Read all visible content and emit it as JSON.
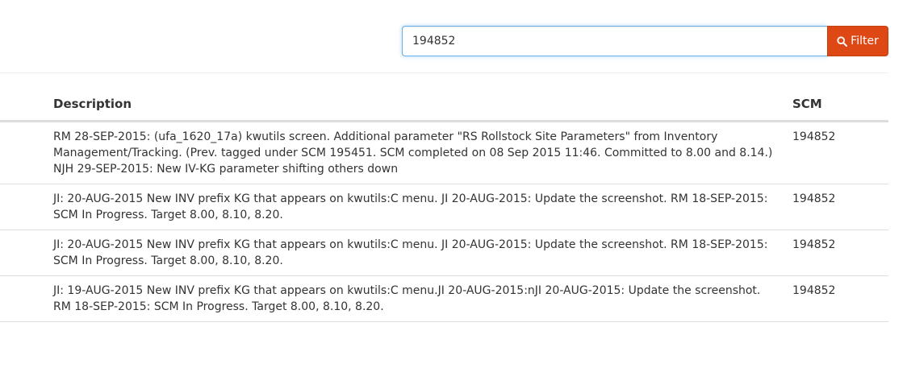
{
  "search": {
    "value": "194852",
    "button_label": "Filter",
    "button_icon": "search-icon",
    "accent_color": "#dd4814"
  },
  "table": {
    "columns": [
      "Description",
      "SCM"
    ],
    "rows": [
      {
        "description": "RM 28-SEP-2015: (ufa_1620_17a) kwutils screen. Additional parameter \"RS Rollstock Site Parameters\" from Inventory Management/Tracking. (Prev. tagged under SCM 195451. SCM completed on 08 Sep 2015 11:46. Committed to 8.00 and 8.14.) NJH 29-SEP-2015: New IV-KG parameter shifting others down",
        "scm": "194852"
      },
      {
        "description": "JI: 20-AUG-2015 New INV prefix KG that appears on kwutils:C menu. JI 20-AUG-2015: Update the screenshot. RM 18-SEP-2015: SCM In Progress. Target 8.00, 8.10, 8.20.",
        "scm": "194852"
      },
      {
        "description": "JI: 20-AUG-2015 New INV prefix KG that appears on kwutils:C menu. JI 20-AUG-2015: Update the screenshot. RM 18-SEP-2015: SCM In Progress. Target 8.00, 8.10, 8.20.",
        "scm": "194852"
      },
      {
        "description": "JI: 19-AUG-2015 New INV prefix KG that appears on kwutils:C menu.JI 20-AUG-2015:nJI 20-AUG-2015: Update the screenshot. RM 18-SEP-2015: SCM In Progress. Target 8.00, 8.10, 8.20.",
        "scm": "194852"
      }
    ]
  }
}
